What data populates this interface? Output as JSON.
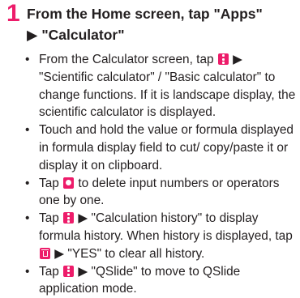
{
  "step": {
    "number": "1",
    "title_line1": "From the Home screen, tap \"Apps\"",
    "title_line2": "▶ \"Calculator\""
  },
  "icons": {
    "menu": "menu-icon",
    "delete": "delete-icon",
    "trash": "trash-icon",
    "accent_color": "#ed1c6a"
  },
  "bullets": {
    "b1": {
      "part1": "From the Calculator screen, tap",
      "part2": "▶ \"Scientific calculator\" / \"Basic calculator\" to change functions. If it is landscape display, the scientific calculator is displayed."
    },
    "b2": {
      "text": "Touch and hold the value or formula displayed in formula display field to cut/ copy/paste it or display it on clipboard."
    },
    "b3": {
      "part1": "Tap",
      "part2": "to delete input numbers or operators one by one."
    },
    "b4": {
      "part1": "Tap",
      "part2": "▶ \"Calculation history\" to display formula history. When history is displayed, tap",
      "part3": "▶ \"YES\" to clear all history."
    },
    "b5": {
      "part1": "Tap",
      "part2": "▶ \"QSlide\" to move to QSlide application mode."
    }
  }
}
